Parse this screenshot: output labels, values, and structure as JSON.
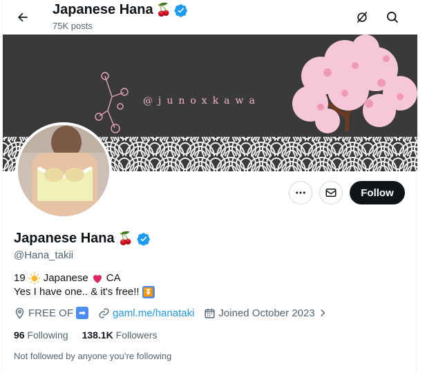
{
  "header": {
    "title": "Japanese Hana",
    "title_emoji": "🍒",
    "posts": "75K posts"
  },
  "banner": {
    "handle_text": "@junoxkawa"
  },
  "actions": {
    "follow_label": "Follow"
  },
  "profile": {
    "name": "Japanese Hana",
    "name_emoji": "🍒",
    "handle": "@Hana_takii",
    "bio_line1_a": "19",
    "bio_line1_b": "Japanese",
    "bio_line1_c": "CA",
    "bio_line2": "Yes I have one.. & it's free!!",
    "location": "FREE OF",
    "website": "gaml.me/hanataki",
    "joined": "Joined October 2023"
  },
  "stats": {
    "following_count": "96",
    "following_label": "Following",
    "followers_count": "138.1K",
    "followers_label": "Followers"
  },
  "note": "Not followed by anyone you’re following",
  "colors": {
    "accent": "#1d9bf0",
    "text": "#0f1419",
    "muted": "#536471",
    "verified": "#1d9bf0"
  }
}
